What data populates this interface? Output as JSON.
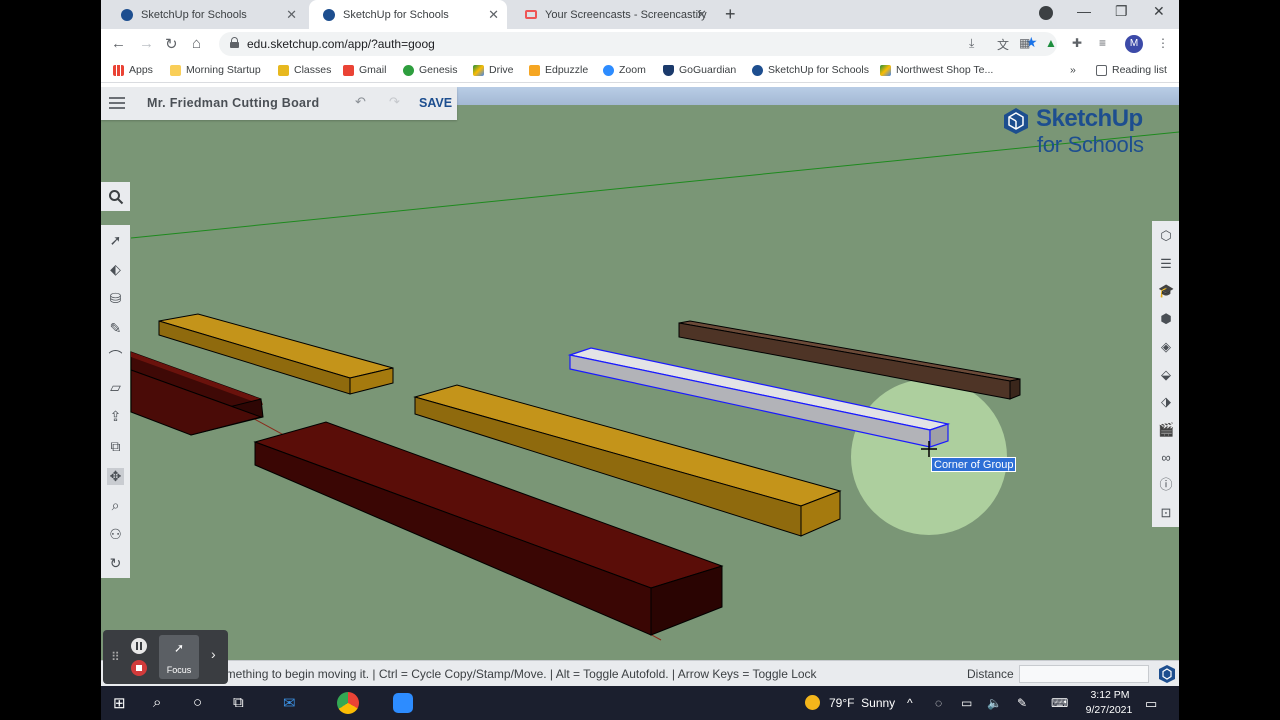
{
  "tabs": [
    {
      "label": "SketchUp for Schools",
      "active": false
    },
    {
      "label": "SketchUp for Schools",
      "active": true
    },
    {
      "label": "Your Screencasts - Screencastify",
      "active": false
    }
  ],
  "address": {
    "url": "edu.sketchup.com/app/?auth=goog"
  },
  "bookmarks": {
    "items": [
      "Apps",
      "Morning Startup",
      "Classes",
      "Gmail",
      "Genesis",
      "Drive",
      "Edpuzzle",
      "Zoom",
      "GoGuardian",
      "SketchUp for Schools",
      "Northwest Shop Te..."
    ],
    "more": "»",
    "reading_list": "Reading list"
  },
  "profile": {
    "initial": "M"
  },
  "app": {
    "doc_title": "Mr. Friedman Cutting Board",
    "save_label": "SAVE",
    "brand_line1": "SketchUp",
    "brand_line2": "for Schools",
    "tooltip": "Corner of Group",
    "status_text": "omething to begin moving it. | Ctrl = Cycle Copy/Stamp/Move. | Alt = Toggle Autofold. | Arrow Keys = Toggle Lock",
    "distance_label": "Distance",
    "distance_value": ""
  },
  "screencastify": {
    "focus_label": "Focus"
  },
  "taskbar": {
    "temperature": "79°F",
    "condition": "Sunny",
    "time": "3:12 PM",
    "date": "9/27/2021"
  },
  "colors": {
    "ground": "#7a9676",
    "maple": "#b8860b",
    "padauk": "#5a0d08",
    "walnut": "#5c4031",
    "selected": "#c6c6c6",
    "selection_outline": "#1a1aff",
    "brand_blue": "#1d4e8f"
  }
}
